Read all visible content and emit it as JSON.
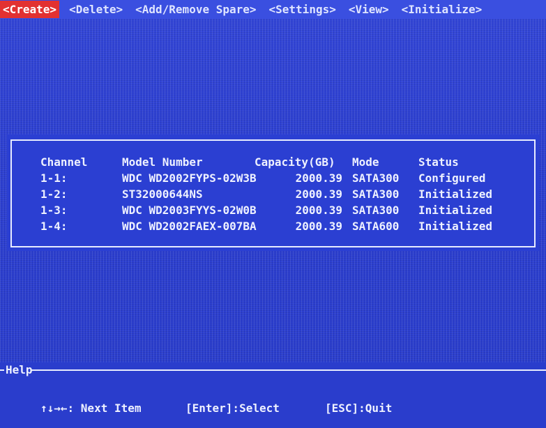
{
  "menu": {
    "items": [
      "<Create>",
      "<Delete>",
      "<Add/Remove Spare>",
      "<Settings>",
      "<View>",
      "<Initialize>"
    ],
    "active": "<Create>",
    "active_color": "#e23131"
  },
  "table": {
    "headers": {
      "channel": "Channel",
      "model": "Model Number",
      "capacity": "Capacity(GB)",
      "mode": "Mode",
      "status": "Status"
    },
    "rows": [
      {
        "channel": "1-1:",
        "model": "WDC WD2002FYPS-02W3B",
        "capacity": "2000.39",
        "mode": "SATA300",
        "status": "Configured"
      },
      {
        "channel": "1-2:",
        "model": "ST32000644NS",
        "capacity": "2000.39",
        "mode": "SATA300",
        "status": "Initialized"
      },
      {
        "channel": "1-3:",
        "model": "WDC WD2003FYYS-02W0B",
        "capacity": "2000.39",
        "mode": "SATA300",
        "status": "Initialized"
      },
      {
        "channel": "1-4:",
        "model": "WDC WD2002FAEX-007BA",
        "capacity": "2000.39",
        "mode": "SATA600",
        "status": "Initialized"
      }
    ]
  },
  "help": {
    "title": "Help",
    "nav": "↑↓→←: Next Item",
    "enter": "[Enter]:Select",
    "esc": "[ESC]:Quit"
  },
  "colors": {
    "background": "#2a3fd0",
    "text": "#eef1ff"
  }
}
